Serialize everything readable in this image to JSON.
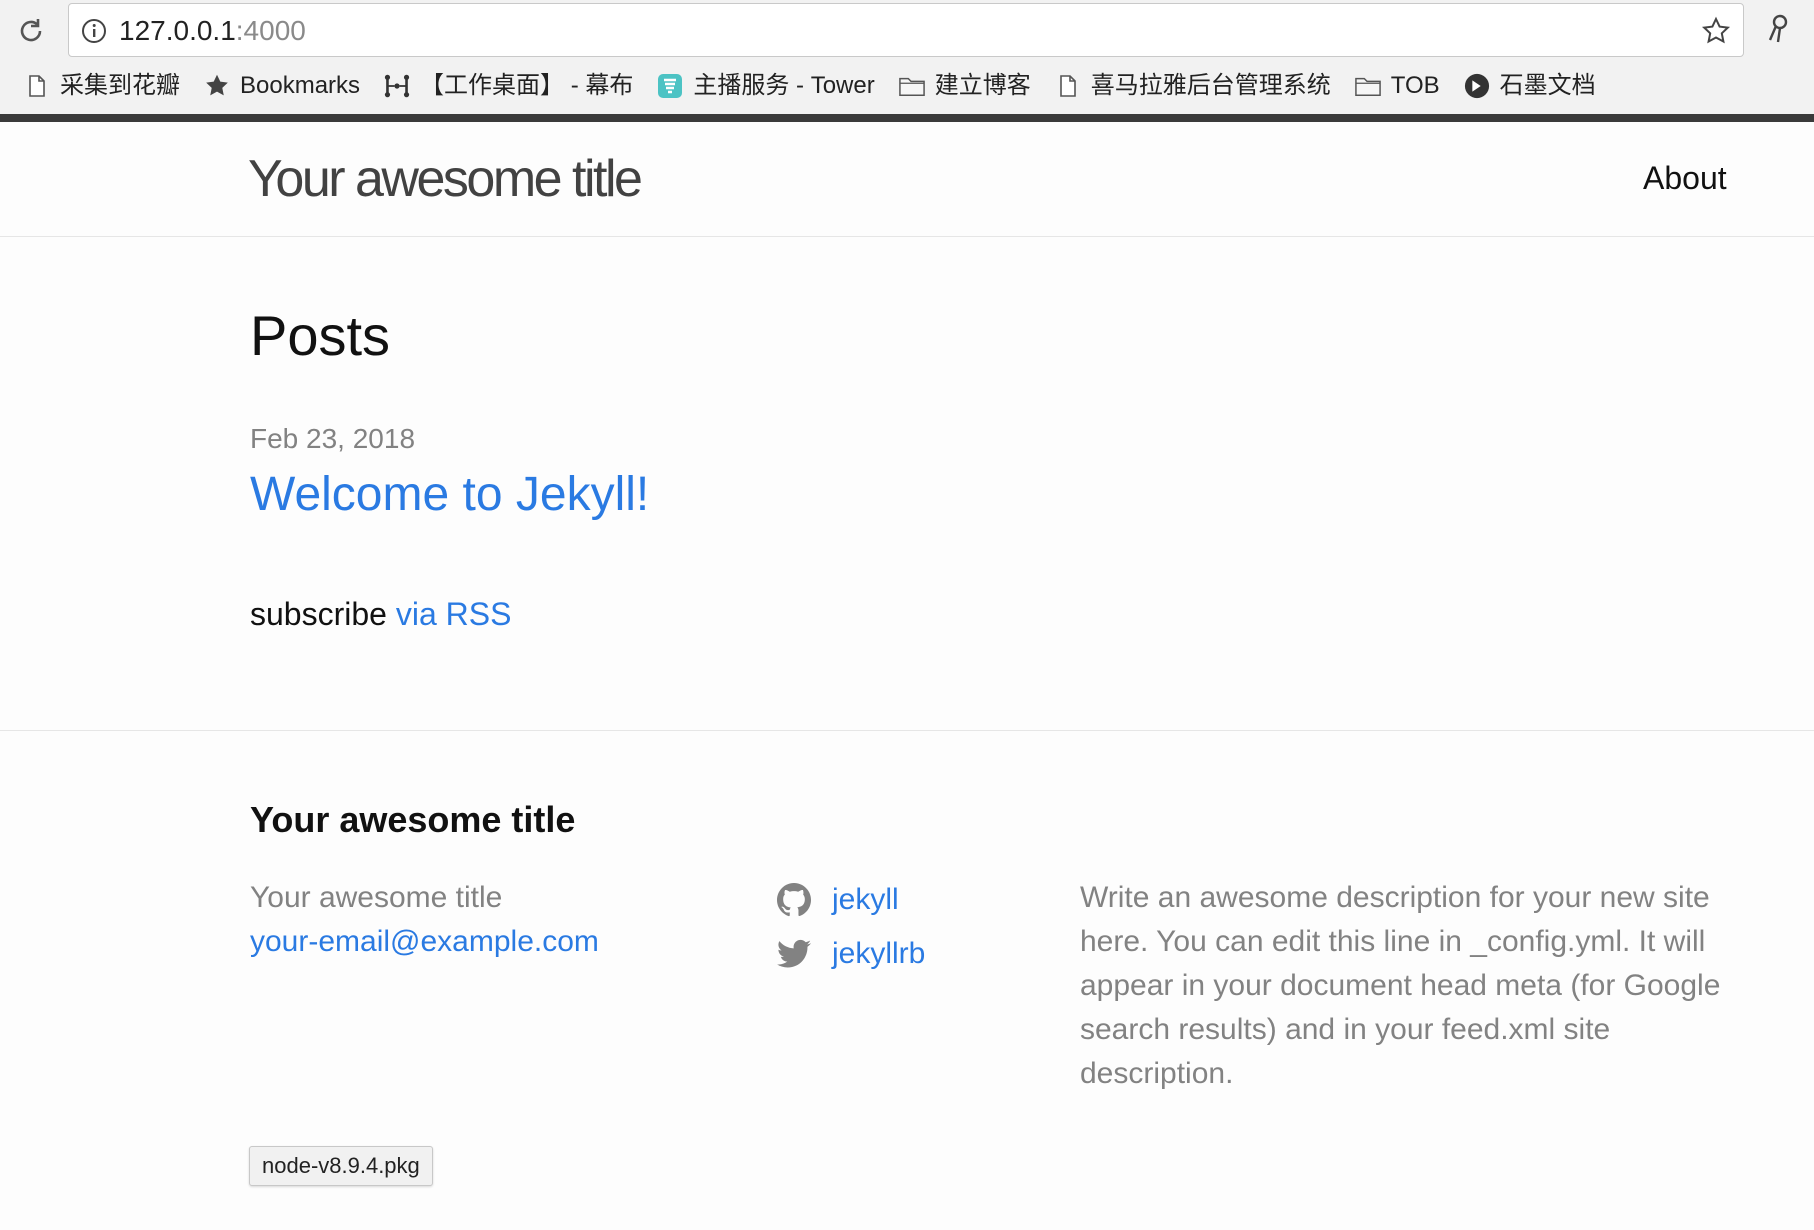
{
  "browser": {
    "url_host": "127.0.0.1",
    "url_port": ":4000",
    "bookmarks": [
      {
        "label": "采集到花瓣",
        "icon": "page-icon"
      },
      {
        "label": "Bookmarks",
        "icon": "star-icon"
      },
      {
        "label": "【工作桌面】 - 幕布",
        "icon": "mubu-icon"
      },
      {
        "label": "主播服务 - Tower",
        "icon": "tower-icon"
      },
      {
        "label": "建立博客",
        "icon": "folder-icon"
      },
      {
        "label": "喜马拉雅后台管理系统",
        "icon": "page-icon"
      },
      {
        "label": "TOB",
        "icon": "folder-icon"
      },
      {
        "label": "石墨文档",
        "icon": "shimo-icon"
      }
    ]
  },
  "header": {
    "site_title": "Your awesome title",
    "nav_about": "About"
  },
  "main": {
    "heading": "Posts",
    "post": {
      "date": "Feb 23, 2018",
      "title": "Welcome to Jekyll!"
    },
    "rss_prefix": "subscribe",
    "rss_link": "via RSS"
  },
  "footer": {
    "heading": "Your awesome title",
    "name": "Your awesome title",
    "email": "your-email@example.com",
    "github": "jekyll",
    "twitter": "jekyllrb",
    "description": "Write an awesome description for your new site here. You can edit this line in _config.yml. It will appear in your document head meta (for Google search results) and in your feed.xml site description."
  },
  "download": {
    "filename": "node-v8.9.4.pkg"
  },
  "colors": {
    "link": "#2a7ae2",
    "muted": "#828282",
    "chrome_bg": "#f2f2f2"
  }
}
